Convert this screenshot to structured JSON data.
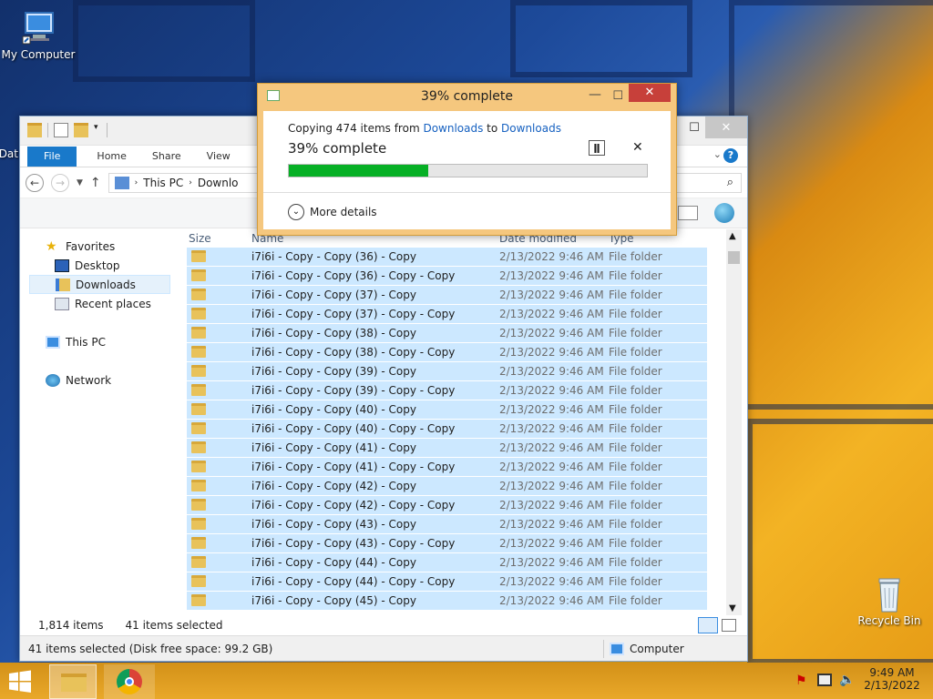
{
  "desktop": {
    "icons": [
      {
        "label": "My Computer"
      },
      {
        "label": "Recycle Bin"
      },
      {
        "label": "Dat"
      }
    ]
  },
  "copy_dialog": {
    "title": "39% complete",
    "copying_prefix": "Copying 474 items from ",
    "source": "Downloads",
    "to_word": " to ",
    "destination": "Downloads",
    "status": "39% complete",
    "progress": 0.39,
    "more_details": "More details",
    "pause_icon": "pause-icon",
    "cancel_icon": "close-icon"
  },
  "explorer": {
    "ribbon_tabs": {
      "file": "File",
      "home": "Home",
      "share": "Share",
      "view": "View"
    },
    "breadcrumb": {
      "this_pc": "This PC",
      "current": "Downlo"
    },
    "nav": {
      "favorites": "Favorites",
      "desktop": "Desktop",
      "downloads": "Downloads",
      "recent": "Recent places",
      "this_pc": "This PC",
      "network": "Network"
    },
    "columns": {
      "size": "Size",
      "name": "Name",
      "date": "Date modified",
      "type": "Type"
    },
    "rows": [
      {
        "name": "i7i6i - Copy - Copy (36) - Copy",
        "date": "2/13/2022 9:46 AM",
        "type": "File folder"
      },
      {
        "name": "i7i6i - Copy - Copy (36) - Copy - Copy",
        "date": "2/13/2022 9:46 AM",
        "type": "File folder"
      },
      {
        "name": "i7i6i - Copy - Copy (37) - Copy",
        "date": "2/13/2022 9:46 AM",
        "type": "File folder"
      },
      {
        "name": "i7i6i - Copy - Copy (37) - Copy - Copy",
        "date": "2/13/2022 9:46 AM",
        "type": "File folder"
      },
      {
        "name": "i7i6i - Copy - Copy (38) - Copy",
        "date": "2/13/2022 9:46 AM",
        "type": "File folder"
      },
      {
        "name": "i7i6i - Copy - Copy (38) - Copy - Copy",
        "date": "2/13/2022 9:46 AM",
        "type": "File folder"
      },
      {
        "name": "i7i6i - Copy - Copy (39) - Copy",
        "date": "2/13/2022 9:46 AM",
        "type": "File folder"
      },
      {
        "name": "i7i6i - Copy - Copy (39) - Copy - Copy",
        "date": "2/13/2022 9:46 AM",
        "type": "File folder"
      },
      {
        "name": "i7i6i - Copy - Copy (40) - Copy",
        "date": "2/13/2022 9:46 AM",
        "type": "File folder"
      },
      {
        "name": "i7i6i - Copy - Copy (40) - Copy - Copy",
        "date": "2/13/2022 9:46 AM",
        "type": "File folder"
      },
      {
        "name": "i7i6i - Copy - Copy (41) - Copy",
        "date": "2/13/2022 9:46 AM",
        "type": "File folder"
      },
      {
        "name": "i7i6i - Copy - Copy (41) - Copy - Copy",
        "date": "2/13/2022 9:46 AM",
        "type": "File folder"
      },
      {
        "name": "i7i6i - Copy - Copy (42) - Copy",
        "date": "2/13/2022 9:46 AM",
        "type": "File folder"
      },
      {
        "name": "i7i6i - Copy - Copy (42) - Copy - Copy",
        "date": "2/13/2022 9:46 AM",
        "type": "File folder"
      },
      {
        "name": "i7i6i - Copy - Copy (43) - Copy",
        "date": "2/13/2022 9:46 AM",
        "type": "File folder"
      },
      {
        "name": "i7i6i - Copy - Copy (43) - Copy - Copy",
        "date": "2/13/2022 9:46 AM",
        "type": "File folder"
      },
      {
        "name": "i7i6i - Copy - Copy (44) - Copy",
        "date": "2/13/2022 9:46 AM",
        "type": "File folder"
      },
      {
        "name": "i7i6i - Copy - Copy (44) - Copy - Copy",
        "date": "2/13/2022 9:46 AM",
        "type": "File folder"
      },
      {
        "name": "i7i6i - Copy - Copy (45) - Copy",
        "date": "2/13/2022 9:46 AM",
        "type": "File folder"
      }
    ],
    "status": {
      "items": "1,814 items",
      "selected": "41 items selected"
    },
    "details": {
      "selection": "41 items selected (Disk free space: 99.2 GB)",
      "location": "Computer"
    }
  },
  "taskbar": {
    "time": "9:49 AM",
    "date": "2/13/2022"
  },
  "colors": {
    "accent": "#1979ca",
    "progress": "#06b025",
    "selection": "#cce8ff",
    "dialog_frame": "#f5c77e",
    "close": "#c7403a"
  }
}
